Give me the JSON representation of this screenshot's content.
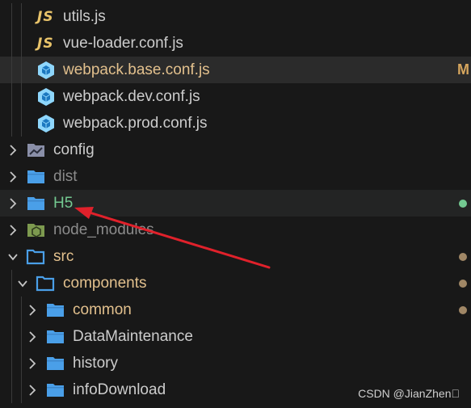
{
  "explorer": {
    "items": [
      {
        "label": "utils.js",
        "kind": "js-file",
        "icon_text": "JS",
        "level": 2,
        "color": "#cccccc"
      },
      {
        "label": "vue-loader.conf.js",
        "kind": "js-file",
        "icon_text": "JS",
        "level": 2,
        "color": "#cccccc"
      },
      {
        "label": "webpack.base.conf.js",
        "kind": "webpack-file",
        "level": 2,
        "color": "#e2c08d",
        "selected": true,
        "status": "M"
      },
      {
        "label": "webpack.dev.conf.js",
        "kind": "webpack-file",
        "level": 2,
        "color": "#cccccc"
      },
      {
        "label": "webpack.prod.conf.js",
        "kind": "webpack-file",
        "level": 2,
        "color": "#cccccc"
      },
      {
        "label": "config",
        "kind": "config-folder",
        "level": 0,
        "expanded": false,
        "color": "#cccccc"
      },
      {
        "label": "dist",
        "kind": "folder",
        "level": 0,
        "expanded": false,
        "color": "#8b8b8b"
      },
      {
        "label": "H5",
        "kind": "folder",
        "level": 0,
        "expanded": false,
        "color": "#73c991",
        "hovered": true,
        "status_dot": "#73c991"
      },
      {
        "label": "node_modules",
        "kind": "node-folder",
        "level": 0,
        "expanded": false,
        "color": "#8b8b8b"
      },
      {
        "label": "src",
        "kind": "folder-open",
        "level": 0,
        "expanded": true,
        "color": "#e2c08d",
        "status_dot": "#a08766"
      },
      {
        "label": "components",
        "kind": "folder-open",
        "level": 1,
        "expanded": true,
        "color": "#e2c08d",
        "status_dot": "#a08766"
      },
      {
        "label": "common",
        "kind": "folder",
        "level": 2,
        "expanded": false,
        "color": "#e2c08d",
        "status_dot": "#a08766"
      },
      {
        "label": "DataMaintenance",
        "kind": "folder",
        "level": 2,
        "expanded": false,
        "color": "#cccccc"
      },
      {
        "label": "history",
        "kind": "folder",
        "level": 2,
        "expanded": false,
        "color": "#cccccc"
      },
      {
        "label": "infoDownload",
        "kind": "folder",
        "level": 2,
        "expanded": false,
        "color": "#cccccc"
      }
    ]
  },
  "colors": {
    "folder_blue": "#4a9fe8",
    "arrow_red": "#e0212b",
    "selection_bg": "#2b2b2b"
  },
  "watermark": "CSDN @JianZhen\u0000"
}
